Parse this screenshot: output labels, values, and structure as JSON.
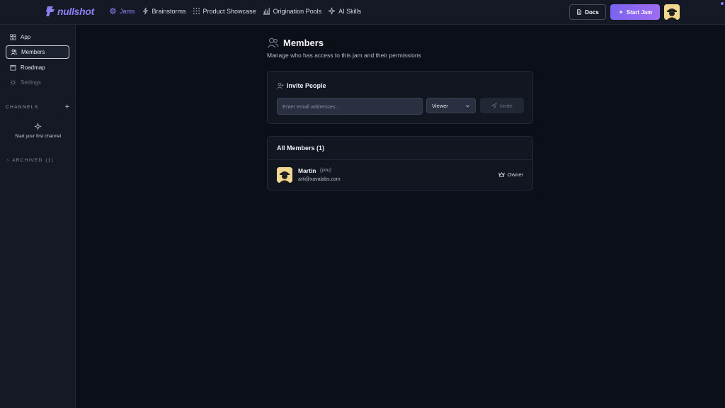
{
  "brand": {
    "name": "nullshot",
    "logo_icon": "nullshot-logo-icon",
    "accent": "#8f7ef2"
  },
  "nav": {
    "links": [
      {
        "label": "Jams",
        "icon": "gear-sparkle-icon",
        "active": true
      },
      {
        "label": "Brainstorms",
        "icon": "lightning-icon"
      },
      {
        "label": "Product Showcase",
        "icon": "grid-dots-icon"
      },
      {
        "label": "Origination Pools",
        "icon": "bar-chart-icon"
      },
      {
        "label": "AI Skills",
        "icon": "sparkles-icon"
      }
    ],
    "docs_label": "Docs",
    "start_label": "Start Jam",
    "start_gradient": [
      "#7a63ee",
      "#a06cf0"
    ]
  },
  "sidebar": {
    "items": [
      {
        "label": "App",
        "icon": "grid-icon"
      },
      {
        "label": "Members",
        "icon": "users-icon",
        "active": true
      },
      {
        "label": "Roadmap",
        "icon": "calendar-icon"
      },
      {
        "label": "Settings",
        "icon": "gear-icon",
        "disabled": true
      }
    ],
    "channels_label": "CHANNELS",
    "add_channel": "+",
    "empty_channel_text": "Start your first channel",
    "archived_label": "ARCHIVED",
    "archived_count": "(1)"
  },
  "page": {
    "title": "Members",
    "subtitle": "Manage who has access to this jam and their permissions"
  },
  "invite": {
    "title": "Invite People",
    "email_placeholder": "Enter email addresses...",
    "role_selected": "Viewer",
    "button_label": "Invite"
  },
  "members": {
    "heading": "All Members (1)",
    "list": [
      {
        "name": "Martin",
        "you_tag": "(you)",
        "email": "arti@xavalabs.com",
        "role": "Owner",
        "role_icon": "crown-icon"
      }
    ]
  }
}
